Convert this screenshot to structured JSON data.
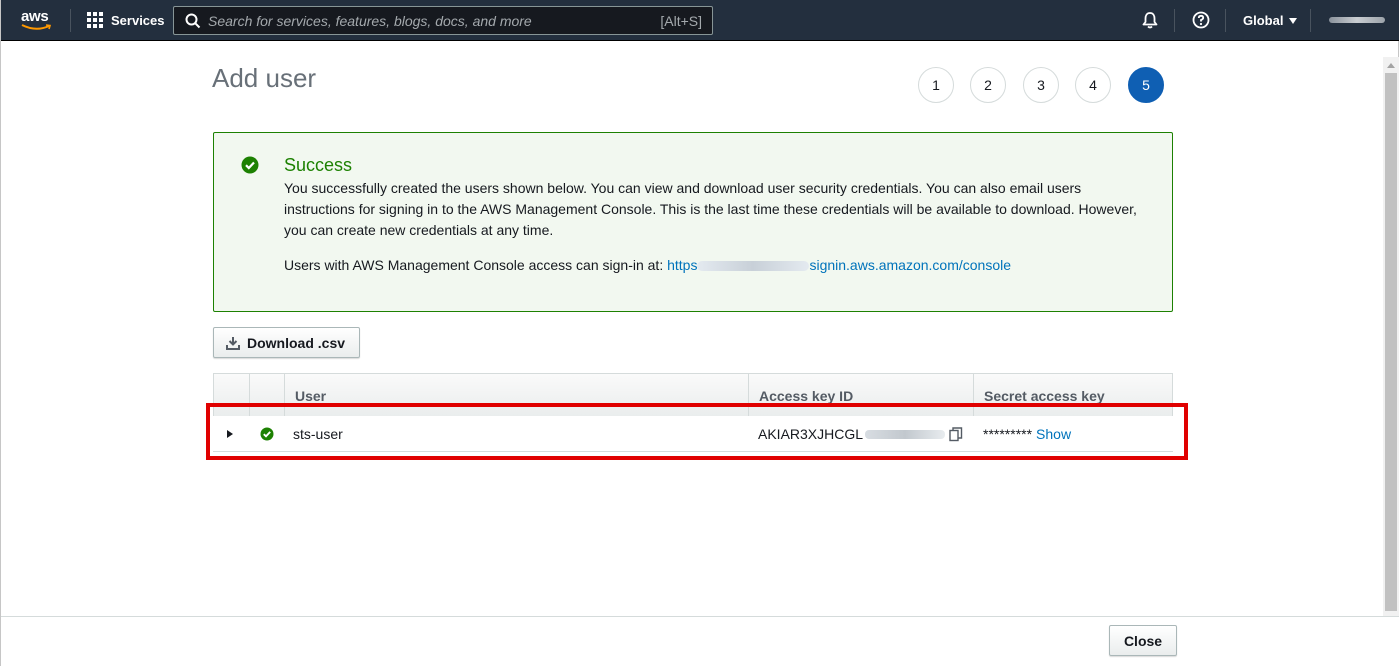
{
  "topnav": {
    "logo_text": "aws",
    "services_label": "Services",
    "search_placeholder": "Search for services, features, blogs, docs, and more",
    "search_shortcut": "[Alt+S]",
    "region_label": "Global"
  },
  "page": {
    "title": "Add user",
    "steps": [
      "1",
      "2",
      "3",
      "4",
      "5"
    ],
    "active_step": "5"
  },
  "success": {
    "title": "Success",
    "message": "You successfully created the users shown below. You can view and download user security credentials. You can also email users instructions for signing in to the AWS Management Console. This is the last time these credentials will be available to download. However, you can create new credentials at any time.",
    "signin_prefix": "Users with AWS Management Console access can sign-in at:",
    "signin_link_start": "https",
    "signin_link_end": "signin.aws.amazon.com/console"
  },
  "actions": {
    "download_label": "Download .csv",
    "close_label": "Close"
  },
  "table": {
    "columns": [
      "",
      "",
      "User",
      "Access key ID",
      "Secret access key"
    ],
    "rows": [
      {
        "user": "sts-user",
        "access_key_prefix": "AKIAR3XJHCGL",
        "secret_masked": "*********",
        "show_label": "Show"
      }
    ]
  },
  "colors": {
    "nav_bg": "#232f3e",
    "success_green": "#1d8102",
    "link_blue": "#0073bb",
    "active_step": "#0f5fb3",
    "highlight_red": "#e00000"
  }
}
